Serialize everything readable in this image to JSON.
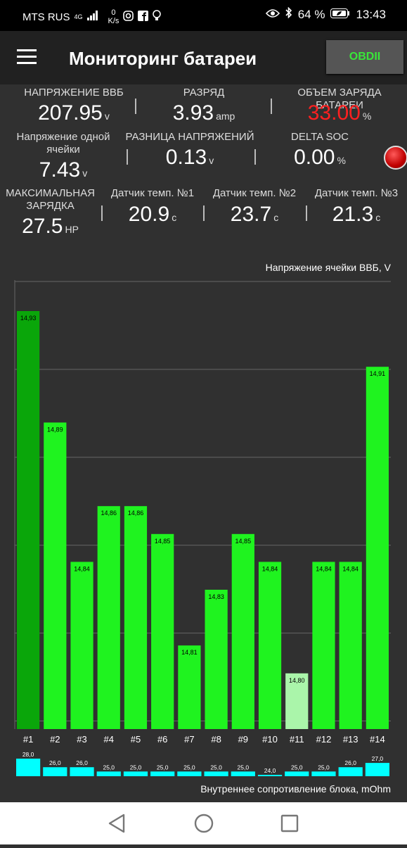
{
  "status_bar": {
    "carrier": "MTS RUS",
    "network": "4G",
    "speed_value": "0",
    "speed_unit": "K/s",
    "battery": "64 %",
    "time": "13:43"
  },
  "app": {
    "title": "Мониторинг батареи",
    "obd_button": "OBDII"
  },
  "metrics": {
    "voltage_hvb": {
      "label": "НАПРЯЖЕНИЕ ВВБ",
      "value": "207.95",
      "unit": "v"
    },
    "discharge": {
      "label": "РАЗРЯД",
      "value": "3.93",
      "unit": "amp"
    },
    "charge_volume": {
      "label": "ОБЪЕМ ЗАРЯДА БАТАРЕИ",
      "value": "33.00",
      "unit": "%",
      "color": "#ff2020"
    },
    "cell_voltage": {
      "label_line1": "Напряжение одной",
      "label_line2": "ячейки",
      "value": "7.43",
      "unit": "v"
    },
    "voltage_diff": {
      "label": "РАЗНИЦА НАПРЯЖЕНИЙ",
      "value": "0.13",
      "unit": "v"
    },
    "delta_soc": {
      "label": "DELTA SOC",
      "value": "0.00",
      "unit": "%"
    },
    "max_charge": {
      "label_line1": "МАКСИМАЛЬНАЯ",
      "label_line2": "ЗАРЯДКА",
      "value": "27.5",
      "unit": "HP"
    },
    "temp1": {
      "label": "Датчик темп. №1",
      "value": "20.9",
      "unit": "c"
    },
    "temp2": {
      "label": "Датчик темп. №2",
      "value": "23.7",
      "unit": "c"
    },
    "temp3": {
      "label": "Датчик темп. №3",
      "value": "21.3",
      "unit": "c"
    }
  },
  "chart_data": {
    "type": "bar",
    "title": "Напряжение ячейки ВВБ, V",
    "categories": [
      "#1",
      "#2",
      "#3",
      "#4",
      "#5",
      "#6",
      "#7",
      "#8",
      "#9",
      "#10",
      "#11",
      "#12",
      "#13",
      "#14"
    ],
    "values": [
      14.93,
      14.89,
      14.84,
      14.86,
      14.86,
      14.85,
      14.81,
      14.83,
      14.85,
      14.84,
      14.8,
      14.84,
      14.84,
      14.91
    ],
    "value_labels": [
      "14,93",
      "14,89",
      "14,84",
      "14,86",
      "14,86",
      "14,85",
      "14,81",
      "14,83",
      "14,85",
      "14,84",
      "14,80",
      "14,84",
      "14,84",
      "14,91"
    ],
    "ylim": [
      14.78,
      14.93
    ],
    "colors": {
      "max": "#0aa60a",
      "min": "#aaf5aa",
      "normal": "#1ff31f",
      "resistance": "#00ffff"
    },
    "resistance": {
      "title": "Внутреннее сопротивление блока, mOhm",
      "values": [
        28.0,
        26.0,
        26.0,
        25.0,
        25.0,
        25.0,
        25.0,
        25.0,
        25.0,
        24.0,
        25.0,
        25.0,
        26.0,
        27.0
      ],
      "value_labels": [
        "28,0",
        "26,0",
        "26,0",
        "25,0",
        "25,0",
        "25,0",
        "25,0",
        "25,0",
        "25,0",
        "24,0",
        "25,0",
        "25,0",
        "26,0",
        "27,0"
      ]
    }
  }
}
